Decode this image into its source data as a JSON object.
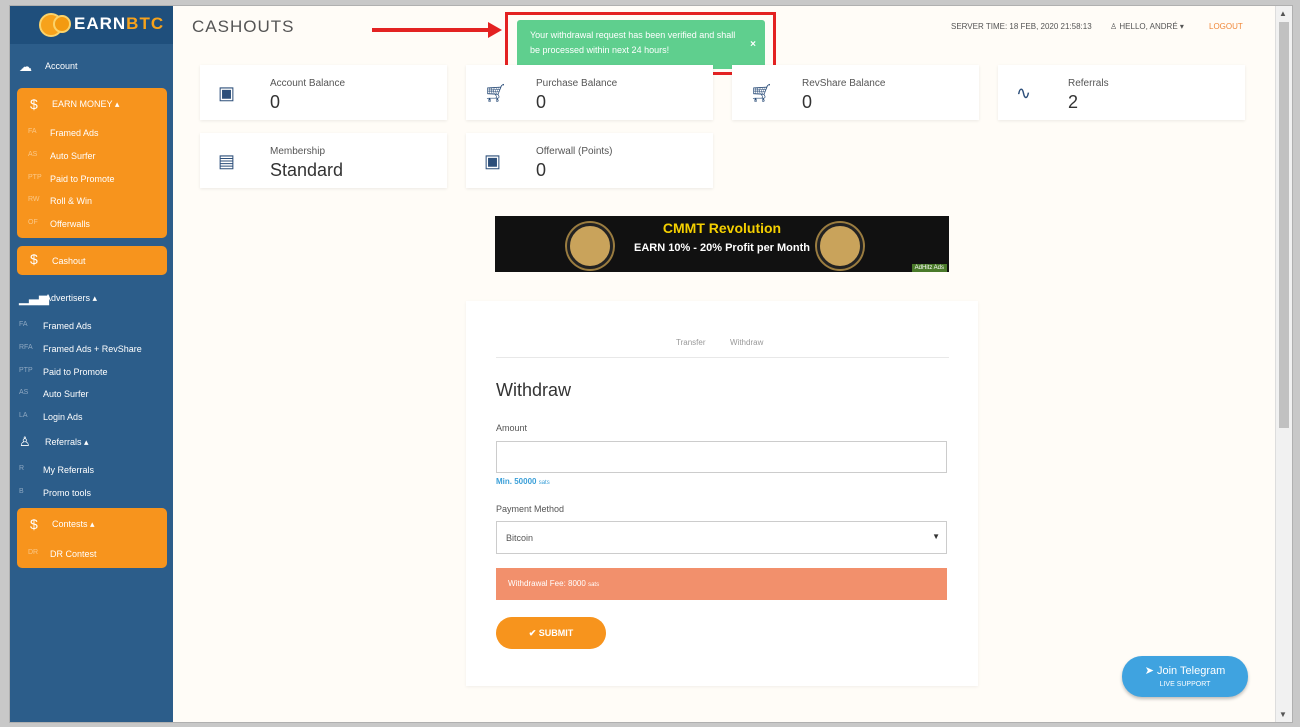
{
  "brand": {
    "name_a": "EARN",
    "name_b": "BTC"
  },
  "header": {
    "title": "CASHOUTS",
    "server_time": "SERVER TIME: 18 FEB, 2020 21:58:13",
    "hello": "HELLO, ANDRÉ",
    "logout": "LOGOUT"
  },
  "alert": {
    "message": "Your withdrawal request has been verified and shall be processed within next 24 hours!",
    "close": "×"
  },
  "sidebar": {
    "account": "Account",
    "earn": {
      "label": "EARN MONEY",
      "items": [
        {
          "ab": "FA",
          "label": "Framed Ads"
        },
        {
          "ab": "AS",
          "label": "Auto Surfer"
        },
        {
          "ab": "PTP",
          "label": "Paid to Promote"
        },
        {
          "ab": "RW",
          "label": "Roll & Win"
        },
        {
          "ab": "OF",
          "label": "Offerwalls"
        }
      ]
    },
    "cashout": "Cashout",
    "advertisers": {
      "label": "Advertisers",
      "items": [
        {
          "ab": "FA",
          "label": "Framed Ads"
        },
        {
          "ab": "RFA",
          "label": "Framed Ads + RevShare"
        },
        {
          "ab": "PTP",
          "label": "Paid to Promote"
        },
        {
          "ab": "AS",
          "label": "Auto Surfer"
        },
        {
          "ab": "LA",
          "label": "Login Ads"
        }
      ]
    },
    "referrals": {
      "label": "Referrals",
      "items": [
        {
          "ab": "R",
          "label": "My Referrals"
        },
        {
          "ab": "B",
          "label": "Promo tools"
        }
      ]
    },
    "contests": {
      "label": "Contests",
      "items": [
        {
          "ab": "DR",
          "label": "DR Contest"
        }
      ]
    }
  },
  "cards": [
    {
      "label": "Account Balance",
      "value": "0"
    },
    {
      "label": "Purchase Balance",
      "value": "0"
    },
    {
      "label": "RevShare Balance",
      "value": "0"
    },
    {
      "label": "Referrals",
      "value": "2"
    },
    {
      "label": "Membership",
      "value": "Standard"
    },
    {
      "label": "Offerwall (Points)",
      "value": "0"
    }
  ],
  "banner": {
    "title": "CMMT Revolution",
    "subtitle": "EARN 10% - 20% Profit per Month",
    "tag": "AdHitz Ads"
  },
  "form": {
    "tabs": [
      "Transfer",
      "Withdraw"
    ],
    "title": "Withdraw",
    "amount_label": "Amount",
    "min_text": "Min. 50000",
    "min_unit": "sats",
    "method_label": "Payment Method",
    "method_value": "Bitcoin",
    "fee_text": "Withdrawal Fee: 8000",
    "fee_unit": "sats",
    "submit": "SUBMIT"
  },
  "telegram": {
    "title": "Join Telegram",
    "sub": "LIVE SUPPORT"
  }
}
